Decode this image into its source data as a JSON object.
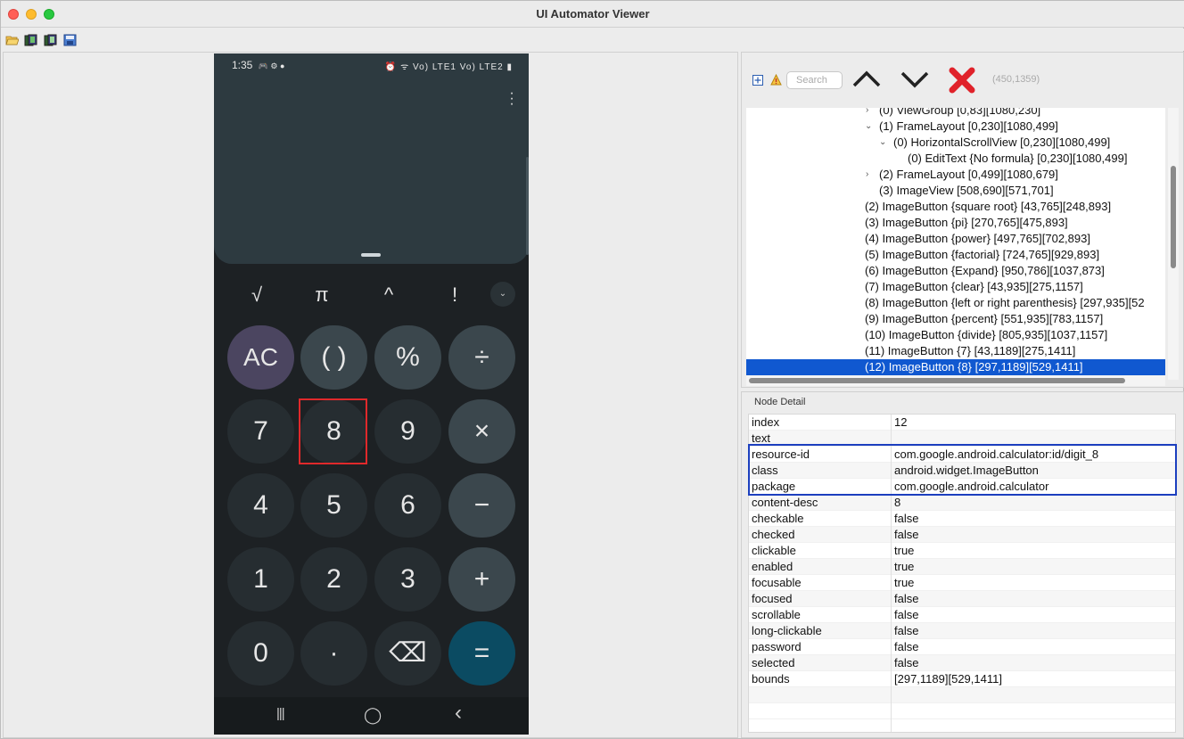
{
  "window": {
    "title": "UI Automator Viewer"
  },
  "toolbar": {
    "icons": [
      "open-folder-icon",
      "device-screenshot-icon",
      "device-screenshot-compressed-icon",
      "save-icon"
    ]
  },
  "phone": {
    "status_time": "1:35",
    "status_icons_left": "🎮 ⚙ ●",
    "status_icons_right": "⏰ ᯤ Vo) LTE1 Vo) LTE2 ▮",
    "scientific": [
      "√",
      "π",
      "^",
      "!"
    ],
    "expand_label": "⌄",
    "keys": {
      "ac": "AC",
      "paren": "( )",
      "percent": "%",
      "divide": "÷",
      "k7": "7",
      "k8": "8",
      "k9": "9",
      "multiply": "×",
      "k4": "4",
      "k5": "5",
      "k6": "6",
      "minus": "−",
      "k1": "1",
      "k2": "2",
      "k3": "3",
      "plus": "+",
      "k0": "0",
      "dot": "·",
      "backspace": "⌫",
      "equals": "="
    },
    "nav": {
      "recents": "|||",
      "home": "◯",
      "back": "‹"
    }
  },
  "hierarchy": {
    "search_placeholder": "Search",
    "coordinates": "(450,1359)",
    "rows": [
      "(0) ViewGroup [0,83][1080,230]",
      "(1) FrameLayout [0,230][1080,499]",
      "(0) HorizontalScrollView [0,230][1080,499]",
      "(0) EditText {No formula} [0,230][1080,499]",
      "(2) FrameLayout [0,499][1080,679]",
      "(3) ImageView [508,690][571,701]",
      "(2) ImageButton {square root} [43,765][248,893]",
      "(3) ImageButton {pi} [270,765][475,893]",
      "(4) ImageButton {power} [497,765][702,893]",
      "(5) ImageButton {factorial} [724,765][929,893]",
      "(6) ImageButton {Expand} [950,786][1037,873]",
      "(7) ImageButton {clear} [43,935][275,1157]",
      "(8) ImageButton {left or right parenthesis} [297,935][52",
      "(9) ImageButton {percent} [551,935][783,1157]",
      "(10) ImageButton {divide} [805,935][1037,1157]",
      "(11) ImageButton {7} [43,1189][275,1411]",
      "(12) ImageButton {8} [297,1189][529,1411]"
    ]
  },
  "node_detail": {
    "title": "Node Detail",
    "rows": [
      {
        "k": "index",
        "v": "12"
      },
      {
        "k": "text",
        "v": ""
      },
      {
        "k": "resource-id",
        "v": "com.google.android.calculator:id/digit_8"
      },
      {
        "k": "class",
        "v": "android.widget.ImageButton"
      },
      {
        "k": "package",
        "v": "com.google.android.calculator"
      },
      {
        "k": "content-desc",
        "v": "8"
      },
      {
        "k": "checkable",
        "v": "false"
      },
      {
        "k": "checked",
        "v": "false"
      },
      {
        "k": "clickable",
        "v": "true"
      },
      {
        "k": "enabled",
        "v": "true"
      },
      {
        "k": "focusable",
        "v": "true"
      },
      {
        "k": "focused",
        "v": "false"
      },
      {
        "k": "scrollable",
        "v": "false"
      },
      {
        "k": "long-clickable",
        "v": "false"
      },
      {
        "k": "password",
        "v": "false"
      },
      {
        "k": "selected",
        "v": "false"
      },
      {
        "k": "bounds",
        "v": "[297,1189][529,1411]"
      }
    ]
  }
}
